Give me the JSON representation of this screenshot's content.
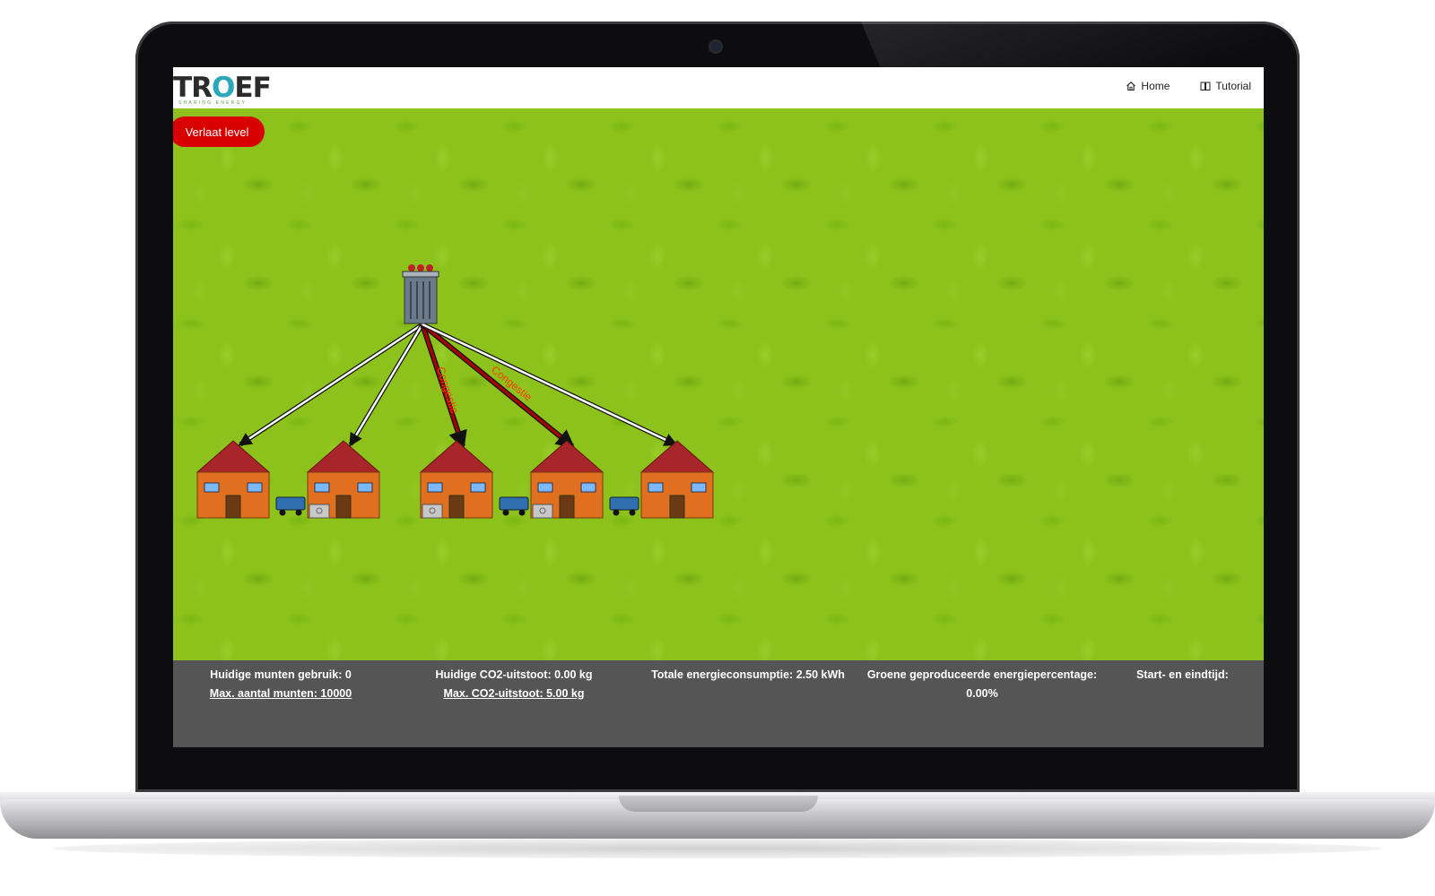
{
  "header": {
    "logo_text_a": "TR",
    "logo_text_o": "O",
    "logo_text_b": "EF",
    "logo_tagline": "SHARING ENERGY",
    "nav": [
      {
        "label": "Home",
        "icon": "home-icon"
      },
      {
        "label": "Tutorial",
        "icon": "book-icon"
      }
    ]
  },
  "game": {
    "exit_button_label": "Verlaat level",
    "line_labels": [
      "Congestie",
      "Congestie"
    ],
    "colors": {
      "grass": "#8cc21b",
      "house_wall": "#e07020",
      "house_roof": "#a8262a",
      "transformer": "#6b7b8c",
      "congestion_line": "#8b0000",
      "normal_line": "#ffffff",
      "exit_button": "#d80000"
    }
  },
  "stats": {
    "coins_used": "Huidige munten gebruik: 0",
    "coins_max": "Max. aantal munten: 10000",
    "co2_current": "Huidige CO2-uitstoot: 0.00 kg",
    "co2_max": "Max. CO2-uitstoot: 5.00 kg",
    "energy_total": "Totale energieconsumptie: 2.50 kWh",
    "green_label": "Groene geproduceerde energiepercentage:",
    "green_value": "0.00%",
    "start_end": "Start- en eindtijd:"
  }
}
